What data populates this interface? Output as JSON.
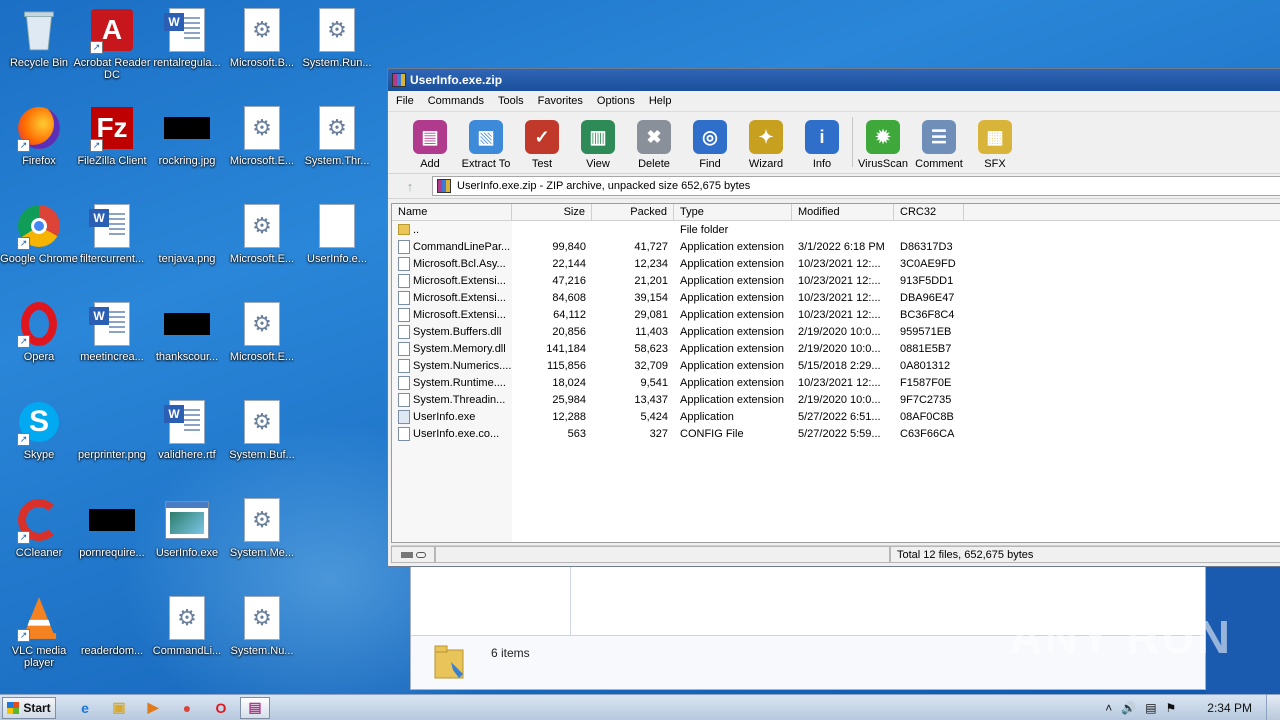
{
  "desktop": {
    "icons": [
      {
        "label": "Recycle Bin",
        "kind": "recycle-bin-icon",
        "col": 0,
        "row": 0
      },
      {
        "label": "Firefox",
        "kind": "firefox-icon",
        "col": 0,
        "row": 1
      },
      {
        "label": "Google Chrome",
        "kind": "chrome-icon",
        "col": 0,
        "row": 2
      },
      {
        "label": "Opera",
        "kind": "opera-icon",
        "col": 0,
        "row": 3
      },
      {
        "label": "Skype",
        "kind": "skype-icon",
        "col": 0,
        "row": 4
      },
      {
        "label": "CCleaner",
        "kind": "ccleaner-icon",
        "col": 0,
        "row": 5
      },
      {
        "label": "VLC media player",
        "kind": "vlc-icon",
        "col": 0,
        "row": 6
      },
      {
        "label": "Acrobat Reader DC",
        "kind": "acrobat-icon",
        "col": 1,
        "row": 0
      },
      {
        "label": "FileZilla Client",
        "kind": "filezilla-icon",
        "col": 1,
        "row": 1
      },
      {
        "label": "filtercurrent...",
        "kind": "word-doc-icon",
        "col": 1,
        "row": 2
      },
      {
        "label": "meetincrea...",
        "kind": "word-doc-icon",
        "col": 1,
        "row": 3
      },
      {
        "label": "perprinter.png",
        "kind": "blank-image-icon",
        "col": 1,
        "row": 4
      },
      {
        "label": "pornrequire...",
        "kind": "black-image-icon",
        "col": 1,
        "row": 5
      },
      {
        "label": "readerdom...",
        "kind": "blank-image-icon",
        "col": 1,
        "row": 6
      },
      {
        "label": "rentalregula...",
        "kind": "word-doc-icon",
        "col": 2,
        "row": 0
      },
      {
        "label": "rockring.jpg",
        "kind": "black-image-icon",
        "col": 2,
        "row": 1
      },
      {
        "label": "tenjava.png",
        "kind": "blank-image-icon",
        "col": 2,
        "row": 2
      },
      {
        "label": "thankscour...",
        "kind": "black-image-icon",
        "col": 2,
        "row": 3
      },
      {
        "label": "validhere.rtf",
        "kind": "word-doc-icon",
        "col": 2,
        "row": 4
      },
      {
        "label": "UserInfo.exe",
        "kind": "app-window-icon",
        "col": 2,
        "row": 5
      },
      {
        "label": "CommandLi...",
        "kind": "dll-gear-icon",
        "col": 2,
        "row": 6
      },
      {
        "label": "Microsoft.B...",
        "kind": "dll-gear-icon",
        "col": 3,
        "row": 0
      },
      {
        "label": "Microsoft.E...",
        "kind": "dll-gear-icon",
        "col": 3,
        "row": 1
      },
      {
        "label": "Microsoft.E...",
        "kind": "dll-gear-icon",
        "col": 3,
        "row": 2
      },
      {
        "label": "Microsoft.E...",
        "kind": "dll-gear-icon",
        "col": 3,
        "row": 3
      },
      {
        "label": "System.Buf...",
        "kind": "dll-gear-icon",
        "col": 3,
        "row": 4
      },
      {
        "label": "System.Me...",
        "kind": "dll-gear-icon",
        "col": 3,
        "row": 5
      },
      {
        "label": "System.Nu...",
        "kind": "dll-gear-icon",
        "col": 3,
        "row": 6
      },
      {
        "label": "System.Run...",
        "kind": "dll-gear-icon",
        "col": 4,
        "row": 0
      },
      {
        "label": "System.Thr...",
        "kind": "dll-gear-icon",
        "col": 4,
        "row": 1
      },
      {
        "label": "UserInfo.e...",
        "kind": "blank-file-icon",
        "col": 4,
        "row": 2
      }
    ]
  },
  "winrar": {
    "title": "UserInfo.exe.zip",
    "menu": [
      "File",
      "Commands",
      "Tools",
      "Favorites",
      "Options",
      "Help"
    ],
    "toolbar": [
      {
        "label": "Add",
        "icon": "add-archive-icon",
        "color": "#b03a8c"
      },
      {
        "label": "Extract To",
        "icon": "extract-folder-icon",
        "color": "#3d8ad8"
      },
      {
        "label": "Test",
        "icon": "test-checklist-icon",
        "color": "#c0392b"
      },
      {
        "label": "View",
        "icon": "view-book-icon",
        "color": "#2e8b57"
      },
      {
        "label": "Delete",
        "icon": "delete-trash-icon",
        "color": "#8a9099"
      },
      {
        "label": "Find",
        "icon": "find-magnifier-icon",
        "color": "#2f6fc9"
      },
      {
        "label": "Wizard",
        "icon": "wizard-wand-icon",
        "color": "#c8a020"
      },
      {
        "label": "Info",
        "icon": "info-icon",
        "color": "#2f6fc9"
      },
      {
        "label": "VirusScan",
        "icon": "virus-scan-icon",
        "color": "#3fa83a"
      },
      {
        "label": "Comment",
        "icon": "comment-icon",
        "color": "#6f8fb8"
      },
      {
        "label": "SFX",
        "icon": "sfx-icon",
        "color": "#d9b43a"
      }
    ],
    "path": "UserInfo.exe.zip - ZIP archive, unpacked size 652,675 bytes",
    "columns": [
      "Name",
      "Size",
      "Packed",
      "Type",
      "Modified",
      "CRC32"
    ],
    "files": [
      {
        "name": "..",
        "size": "",
        "packed": "",
        "type": "File folder",
        "modified": "",
        "crc": "",
        "icon": "folder"
      },
      {
        "name": "CommandLinePar...",
        "size": "99,840",
        "packed": "41,727",
        "type": "Application extension",
        "modified": "3/1/2022 6:18 PM",
        "crc": "D86317D3",
        "icon": "dll"
      },
      {
        "name": "Microsoft.Bcl.Asy...",
        "size": "22,144",
        "packed": "12,234",
        "type": "Application extension",
        "modified": "10/23/2021 12:...",
        "crc": "3C0AE9FD",
        "icon": "dll"
      },
      {
        "name": "Microsoft.Extensi...",
        "size": "47,216",
        "packed": "21,201",
        "type": "Application extension",
        "modified": "10/23/2021 12:...",
        "crc": "913F5DD1",
        "icon": "dll"
      },
      {
        "name": "Microsoft.Extensi...",
        "size": "84,608",
        "packed": "39,154",
        "type": "Application extension",
        "modified": "10/23/2021 12:...",
        "crc": "DBA96E47",
        "icon": "dll"
      },
      {
        "name": "Microsoft.Extensi...",
        "size": "64,112",
        "packed": "29,081",
        "type": "Application extension",
        "modified": "10/23/2021 12:...",
        "crc": "BC36F8C4",
        "icon": "dll"
      },
      {
        "name": "System.Buffers.dll",
        "size": "20,856",
        "packed": "11,403",
        "type": "Application extension",
        "modified": "2/19/2020 10:0...",
        "crc": "959571EB",
        "icon": "dll"
      },
      {
        "name": "System.Memory.dll",
        "size": "141,184",
        "packed": "58,623",
        "type": "Application extension",
        "modified": "2/19/2020 10:0...",
        "crc": "0881E5B7",
        "icon": "dll"
      },
      {
        "name": "System.Numerics....",
        "size": "115,856",
        "packed": "32,709",
        "type": "Application extension",
        "modified": "5/15/2018 2:29...",
        "crc": "0A801312",
        "icon": "dll"
      },
      {
        "name": "System.Runtime....",
        "size": "18,024",
        "packed": "9,541",
        "type": "Application extension",
        "modified": "10/23/2021 12:...",
        "crc": "F1587F0E",
        "icon": "dll"
      },
      {
        "name": "System.Threadin...",
        "size": "25,984",
        "packed": "13,437",
        "type": "Application extension",
        "modified": "2/19/2020 10:0...",
        "crc": "9F7C2735",
        "icon": "dll"
      },
      {
        "name": "UserInfo.exe",
        "size": "12,288",
        "packed": "5,424",
        "type": "Application",
        "modified": "5/27/2022 6:51...",
        "crc": "08AF0C8B",
        "icon": "app"
      },
      {
        "name": "UserInfo.exe.co...",
        "size": "563",
        "packed": "327",
        "type": "CONFIG File",
        "modified": "5/27/2022 5:59...",
        "crc": "C63F66CA",
        "icon": "file"
      }
    ],
    "status": "Total 12 files, 652,675 bytes"
  },
  "explorer": {
    "items_text": "6 items"
  },
  "watermark": "ANY RUN",
  "taskbar": {
    "start_label": "Start",
    "apps": [
      "internet-explorer-icon",
      "file-explorer-icon",
      "media-player-icon",
      "chrome-icon",
      "opera-icon",
      "winrar-icon"
    ],
    "clock": "2:34 PM"
  }
}
